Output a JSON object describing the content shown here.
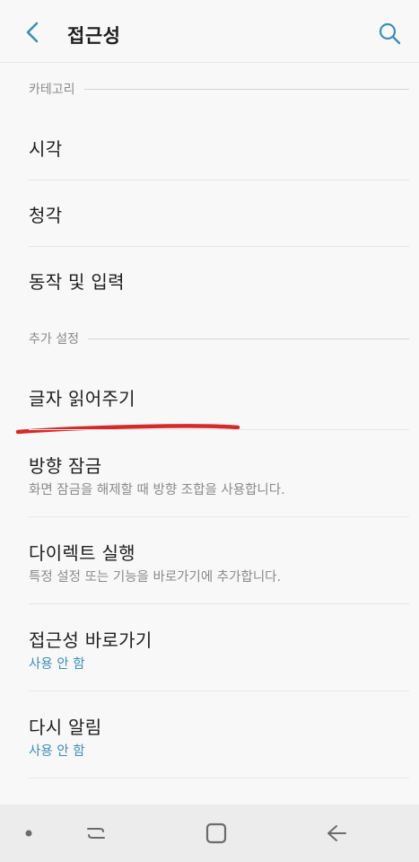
{
  "header": {
    "title": "접근성"
  },
  "sections": {
    "category": "카테고리",
    "extra": "추가 설정"
  },
  "items": {
    "vision": "시각",
    "hearing": "청각",
    "interaction": "동작 및 입력",
    "text_to_speech": "글자 읽어주기",
    "direction_lock": {
      "title": "방향 잠금",
      "subtitle": "화면 잠금을 해제할 때 방향 조합을 사용합니다."
    },
    "direct_access": {
      "title": "다이렉트 실행",
      "subtitle": "특정 설정 또는 기능을 바로가기에 추가합니다."
    },
    "accessibility_shortcut": {
      "title": "접근성 바로가기",
      "status": "사용 안 함"
    },
    "notification_reminder": {
      "title": "다시 알림",
      "status": "사용 안 함"
    }
  },
  "colors": {
    "accent": "#3c8fb5",
    "annotation": "#d42a2a",
    "background": "#f8f8f8"
  },
  "icons": {
    "back": "chevron-left-icon",
    "search": "search-icon",
    "recents": "recents-icon",
    "home": "home-icon",
    "nav_back": "back-arrow-icon"
  }
}
